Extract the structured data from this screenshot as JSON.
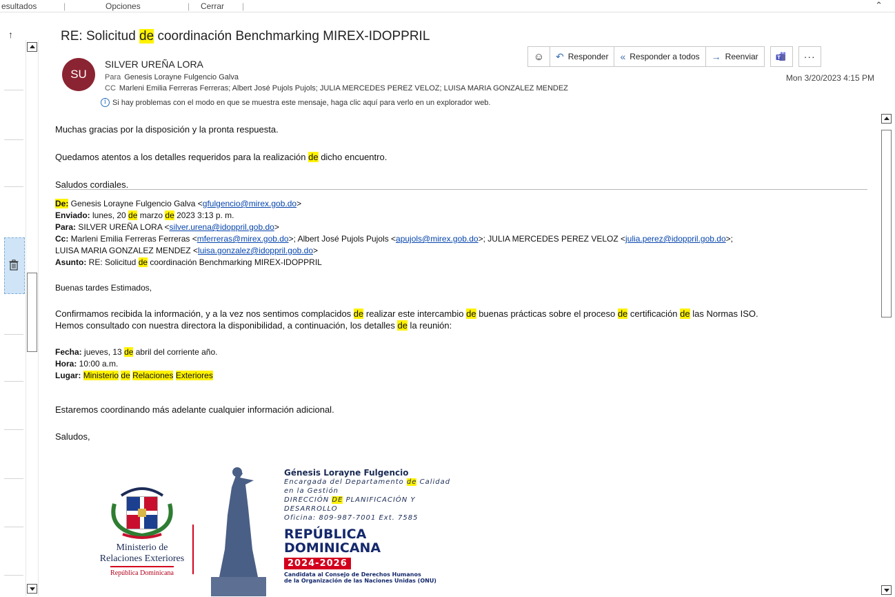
{
  "topbar": {
    "results": "esultados",
    "options": "Opciones",
    "close": "Cerrar"
  },
  "header": {
    "subject_prefix": "RE: Solicitud ",
    "subject_hl": "de",
    "subject_suffix": " coordinación Benchmarking MIREX-IDOPPRIL",
    "avatar_initials": "SU",
    "avatar_color": "#8b2432",
    "sender": "SILVER UREÑA LORA",
    "to_label": "Para",
    "to_value": "Genesis Lorayne Fulgencio Galva",
    "cc_label": "CC",
    "cc_value": "Marleni Emilia Ferreras Ferreras; Albert José Pujols Pujols; JULIA MERCEDES PEREZ VELOZ; LUISA MARIA GONZALEZ MENDEZ",
    "info": "Si hay problemas con el modo en que se muestra este mensaje, haga clic aquí para verlo en un explorador web.",
    "date": "Mon 3/20/2023 4:15 PM"
  },
  "toolbar": {
    "emoji_icon": "smile-icon",
    "reply": "Responder",
    "reply_all": "Responder a todos",
    "forward": "Reenviar",
    "teams_icon": "teams-icon",
    "more": "···"
  },
  "body": {
    "p1": "Muchas gracias por la disposición y la pronta respuesta.",
    "p2_a": "Quedamos atentos a los detalles requeridos para la realización ",
    "hl": "de",
    "p2_b": " dicho encuentro.",
    "p3": "Saludos cordiales.",
    "fwd": {
      "from_label": "De:",
      "from_name": " Genesis Lorayne Fulgencio Galva <",
      "from_email": "gfulgencio@mirex.gob.do",
      "sent_label": "Enviado:",
      "sent_a": " lunes, 20 ",
      "sent_b": " marzo ",
      "sent_c": " 2023 3:13 p. m.",
      "to_label": "Para:",
      "to_name": " SILVER UREÑA LORA <",
      "to_email": "silver.urena@idoppril.gob.do",
      "cc_label": "Cc:",
      "cc_1": " Marleni Emilia Ferreras Ferreras <",
      "cc_1_email": "mferreras@mirex.gob.do",
      "cc_2": ">; Albert José Pujols Pujols <",
      "cc_2_email": "apujols@mirex.gob.do",
      "cc_3": ">; JULIA MERCEDES PEREZ VELOZ <",
      "cc_3_email": "julia.perez@idoppril.gob.do",
      "cc_4": "LUISA MARIA GONZALEZ MENDEZ <",
      "cc_4_email": "luisa.gonzalez@idoppril.gob.do",
      "subject_label": "Asunto:",
      "subject_a": " RE: Solicitud ",
      "subject_b": " coordinación Benchmarking MIREX-IDOPPRIL"
    },
    "greeting": "Buenas tardes Estimados,",
    "c1_a": "Confirmamos recibida la información, y a la vez nos sentimos complacidos ",
    "c1_b": " realizar este intercambio ",
    "c1_c": " buenas prácticas sobre el proceso ",
    "c1_d": " certificación ",
    "c1_e": " las Normas ISO.",
    "c2_a": "Hemos consultado con nuestra directora la disponibilidad, a continuación, los detalles ",
    "c2_b": " la reunión:",
    "fecha_label": "Fecha:",
    "fecha_a": " jueves, 13 ",
    "fecha_b": " abril del corriente año.",
    "hora_label": "Hora:",
    "hora_value": " 10:00 a.m.",
    "lugar_label": "Lugar:",
    "lugar_1": "Ministerio",
    "lugar_2": "Relaciones",
    "lugar_3": "Exteriores",
    "closing": "Estaremos coordinando más adelante cualquier información adicional.",
    "bye": "Saludos,"
  },
  "signature": {
    "name": "Génesis Lorayne Fulgencio",
    "role_a": "Encargada del Departamento ",
    "role_hl": "de",
    "role_b": " Calidad",
    "role_c": "en la Gestión",
    "dept_a": "DIRECCIÓN ",
    "dept_hl": "DE",
    "dept_b": " PLANIFICACIÓN Y",
    "dept_c": "DESARROLLO",
    "phone": "Oficina: 809-987-7001 Ext. 7585",
    "rd_1": "REPÚBLICA",
    "rd_2": "DOMINICANA",
    "years": "2024-2026",
    "cand_1": "Candidata al Consejo de Derechos Humanos",
    "cand_2": "de la Organización de las Naciones Unidas (ONU)",
    "min_1": "Ministerio de",
    "min_2": "Relaciones Exteriores",
    "min_3": "República Dominicana"
  },
  "colors": {
    "highlight": "#fff200",
    "link": "#0645ad",
    "accent": "#3a6fb5",
    "brand_red": "#d3001d",
    "brand_blue": "#14286b"
  }
}
